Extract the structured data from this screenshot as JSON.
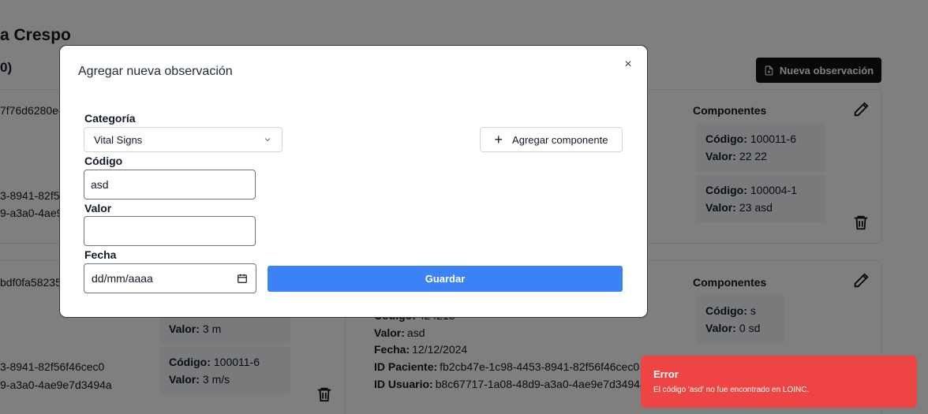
{
  "background": {
    "patient_name_fragment": "a Crespo",
    "count_fragment": "0)",
    "new_observation_button": "Nueva observación",
    "card1": {
      "id_fragment": "7f76d6280ee",
      "line_a": "3-8941-82f5",
      "line_b": "9-a3a0-4ae9",
      "components_title": "Componentes",
      "components": [
        {
          "code_label": "Código:",
          "code": "100011-6",
          "value_label": "Valor:",
          "value": "22 22"
        },
        {
          "code_label": "Código:",
          "code": "100004-1",
          "value_label": "Valor:",
          "value": "23 asd"
        }
      ]
    },
    "card2": {
      "id_fragment": "bdf0fa58235",
      "left_box_value_label": "Valor:",
      "left_box_value": "3 m",
      "left_box2_code_label": "Código:",
      "left_box2_code": "100011-6",
      "left_box2_value_label": "Valor:",
      "left_box2_value": "3 m/s",
      "line_a": "3-8941-82f56f46cec0",
      "line_b": "9-a3a0-4ae9e7d3494a",
      "details": {
        "code_label": "Código:",
        "code_value": "424213",
        "value_label": "Valor:",
        "value_value": "asd",
        "date_label": "Fecha:",
        "date_value": "12/12/2024",
        "patient_label": "ID Paciente:",
        "patient_value": "fb2cb47e-1c98-4453-8941-82f56f46cec0",
        "user_label": "ID Usuario:",
        "user_value": "b8c67717-1a08-48d9-a3a0-4ae9e7d3494a"
      },
      "components_title": "Componentes",
      "components": [
        {
          "code_label": "Código:",
          "code": "s",
          "value_label": "Valor:",
          "value": "0 sd"
        }
      ]
    }
  },
  "modal": {
    "title": "Agregar nueva observación",
    "close_glyph": "×",
    "category_label": "Categoría",
    "category_value": "Vital Signs",
    "code_label": "Código",
    "code_value": "asd",
    "value_label": "Valor",
    "value_value": "",
    "date_label": "Fecha",
    "date_placeholder": "dd/mm/aaaa",
    "add_component_button": "Agregar componente",
    "add_component_glyph": "+",
    "save_button": "Guardar"
  },
  "toast": {
    "title": "Error",
    "message": "El código 'asd' no fue encontrado en LOINC."
  },
  "colors": {
    "primary": "#3b82f6",
    "error": "#ef4444",
    "dark_button": "#111111"
  }
}
